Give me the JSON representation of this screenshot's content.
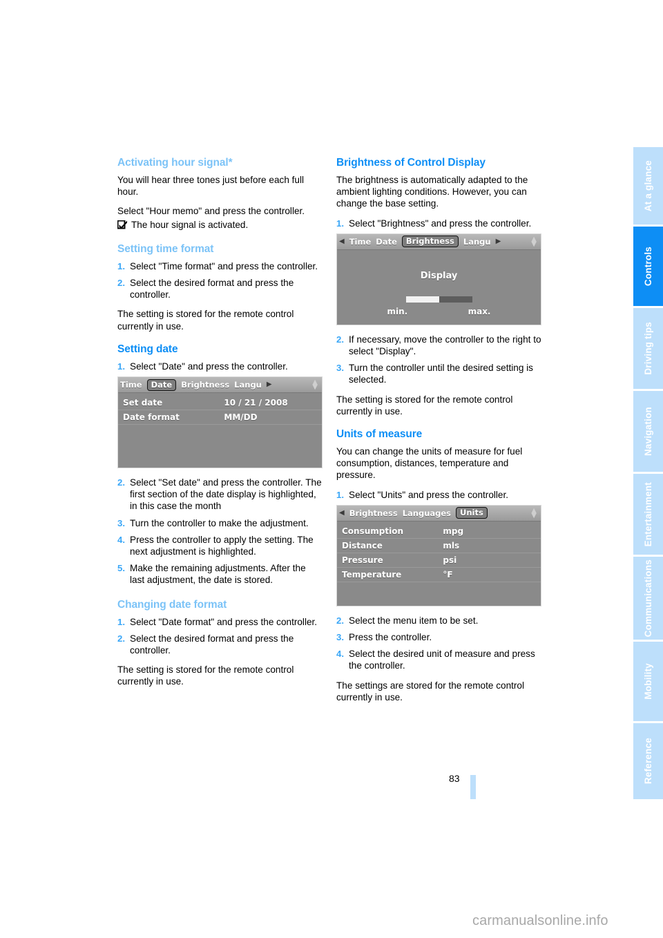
{
  "page": {
    "number": "83",
    "watermark": "carmanualsonline.info"
  },
  "sidenav": {
    "items": [
      {
        "label": "At a glance",
        "active": false
      },
      {
        "label": "Controls",
        "active": true
      },
      {
        "label": "Driving tips",
        "active": false
      },
      {
        "label": "Navigation",
        "active": false
      },
      {
        "label": "Entertainment",
        "active": false
      },
      {
        "label": "Communications",
        "active": false
      },
      {
        "label": "Mobility",
        "active": false
      },
      {
        "label": "Reference",
        "active": false
      }
    ]
  },
  "left_column": {
    "hour_signal": {
      "heading": "Activating hour signal*",
      "p1": "You will hear three tones just before each full hour.",
      "p2": "Select \"Hour memo\" and press the controller.",
      "checkline": "The hour signal is activated."
    },
    "time_format": {
      "heading": "Setting time format",
      "steps": [
        {
          "num": "1.",
          "text": "Select \"Time format\" and press the controller."
        },
        {
          "num": "2.",
          "text": "Select the desired format and press the controller."
        }
      ],
      "note": "The setting is stored for the remote control currently in use."
    },
    "setting_date": {
      "heading": "Setting date",
      "step1": {
        "num": "1.",
        "text": "Select \"Date\" and press the controller."
      },
      "screen": {
        "tabs": [
          "Time",
          "Date",
          "Brightness",
          "Langu"
        ],
        "selected_tab": "Date",
        "rows": [
          {
            "label": "Set date",
            "value": "10 / 21 / 2008"
          },
          {
            "label": "Date format",
            "value": "MM/DD"
          }
        ]
      },
      "steps": [
        {
          "num": "2.",
          "text": "Select \"Set date\" and press the controller. The first section of the date display is highlighted, in this case the month"
        },
        {
          "num": "3.",
          "text": "Turn the controller to make the adjustment."
        },
        {
          "num": "4.",
          "text": "Press the controller to apply the setting. The next adjustment is highlighted."
        },
        {
          "num": "5.",
          "text": "Make the remaining adjustments. After the last adjustment, the date is stored."
        }
      ]
    },
    "date_format": {
      "heading": "Changing date format",
      "steps": [
        {
          "num": "1.",
          "text": "Select \"Date format\" and press the controller."
        },
        {
          "num": "2.",
          "text": "Select the desired format and press the controller."
        }
      ],
      "note": "The setting is stored for the remote control currently in use."
    }
  },
  "right_column": {
    "brightness": {
      "heading": "Brightness of Control Display",
      "p1": "The brightness is automatically adapted to the ambient lighting conditions. However, you can change the base setting.",
      "step1": {
        "num": "1.",
        "text": "Select \"Brightness\" and press the controller."
      },
      "screen": {
        "tabs": [
          "Time",
          "Date",
          "Brightness",
          "Langu"
        ],
        "selected_tab": "Brightness",
        "title": "Display",
        "min_label": "min.",
        "max_label": "max.",
        "slider_percent": 50
      },
      "steps": [
        {
          "num": "2.",
          "text": "If necessary, move the controller to the right to select \"Display\"."
        },
        {
          "num": "3.",
          "text": "Turn the controller until the desired setting is selected."
        }
      ],
      "note": "The setting is stored for the remote control currently in use."
    },
    "units": {
      "heading": "Units of measure",
      "p1": "You can change the units of measure for fuel consumption, distances, temperature and pressure.",
      "step1": {
        "num": "1.",
        "text": "Select \"Units\" and press the controller."
      },
      "screen": {
        "tabs": [
          "Brightness",
          "Languages",
          "Units"
        ],
        "selected_tab": "Units",
        "rows": [
          {
            "label": "Consumption",
            "value": "mpg"
          },
          {
            "label": "Distance",
            "value": "mls"
          },
          {
            "label": "Pressure",
            "value": "psi"
          },
          {
            "label": "Temperature",
            "value": "°F"
          }
        ]
      },
      "steps": [
        {
          "num": "2.",
          "text": "Select the menu item to be set."
        },
        {
          "num": "3.",
          "text": "Press the controller."
        },
        {
          "num": "4.",
          "text": "Select the desired unit of measure and press the controller."
        }
      ],
      "note": "The settings are stored for the remote control currently in use."
    }
  }
}
